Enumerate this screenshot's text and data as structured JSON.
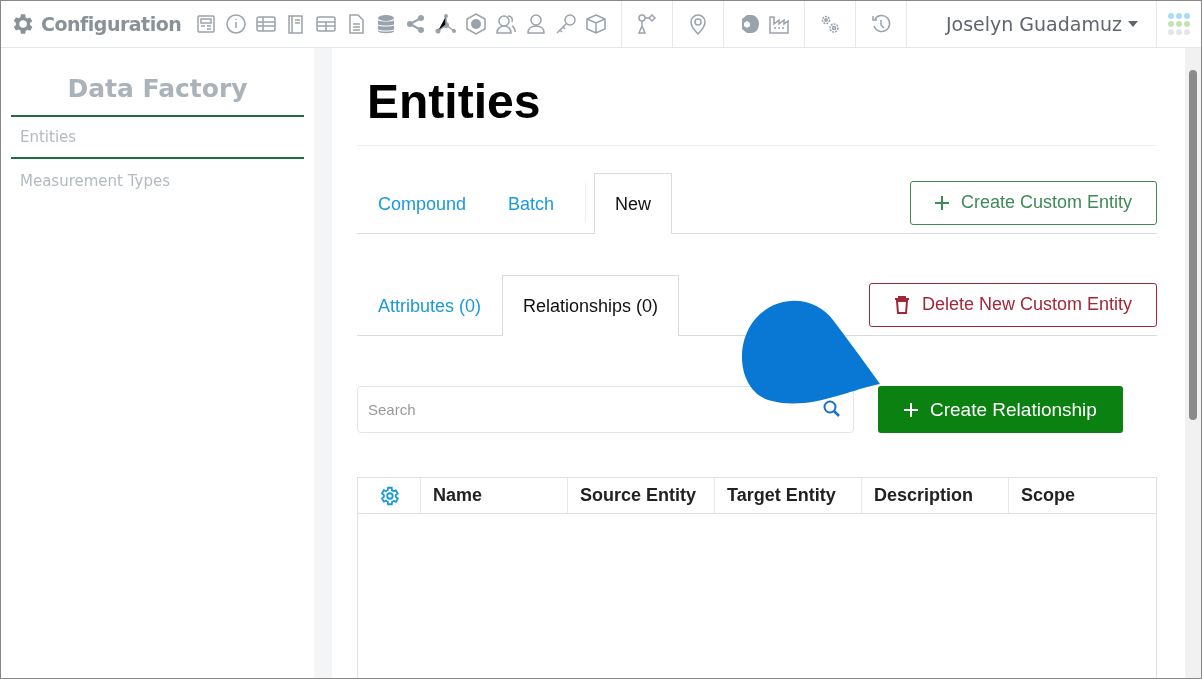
{
  "app": {
    "title": "Configuration"
  },
  "user": {
    "name": "Joselyn Guadamuz"
  },
  "sidebar": {
    "title": "Data Factory",
    "items": [
      {
        "label": "Entities",
        "selected": true
      },
      {
        "label": "Measurement Types",
        "selected": false
      }
    ]
  },
  "page": {
    "title": "Entities"
  },
  "entity_tabs": [
    {
      "label": "Compound",
      "selected": false
    },
    {
      "label": "Batch",
      "selected": false
    },
    {
      "label": "New",
      "selected": true
    }
  ],
  "create_entity_button": "Create Custom Entity",
  "sub_tabs": [
    {
      "label": "Attributes (0)",
      "selected": false
    },
    {
      "label": "Relationships (0)",
      "selected": true
    }
  ],
  "delete_button": "Delete New Custom Entity",
  "search": {
    "placeholder": "Search"
  },
  "create_relationship_button": "Create Relationship",
  "table": {
    "columns": [
      "Name",
      "Source Entity",
      "Target Entity",
      "Description",
      "Scope"
    ]
  }
}
